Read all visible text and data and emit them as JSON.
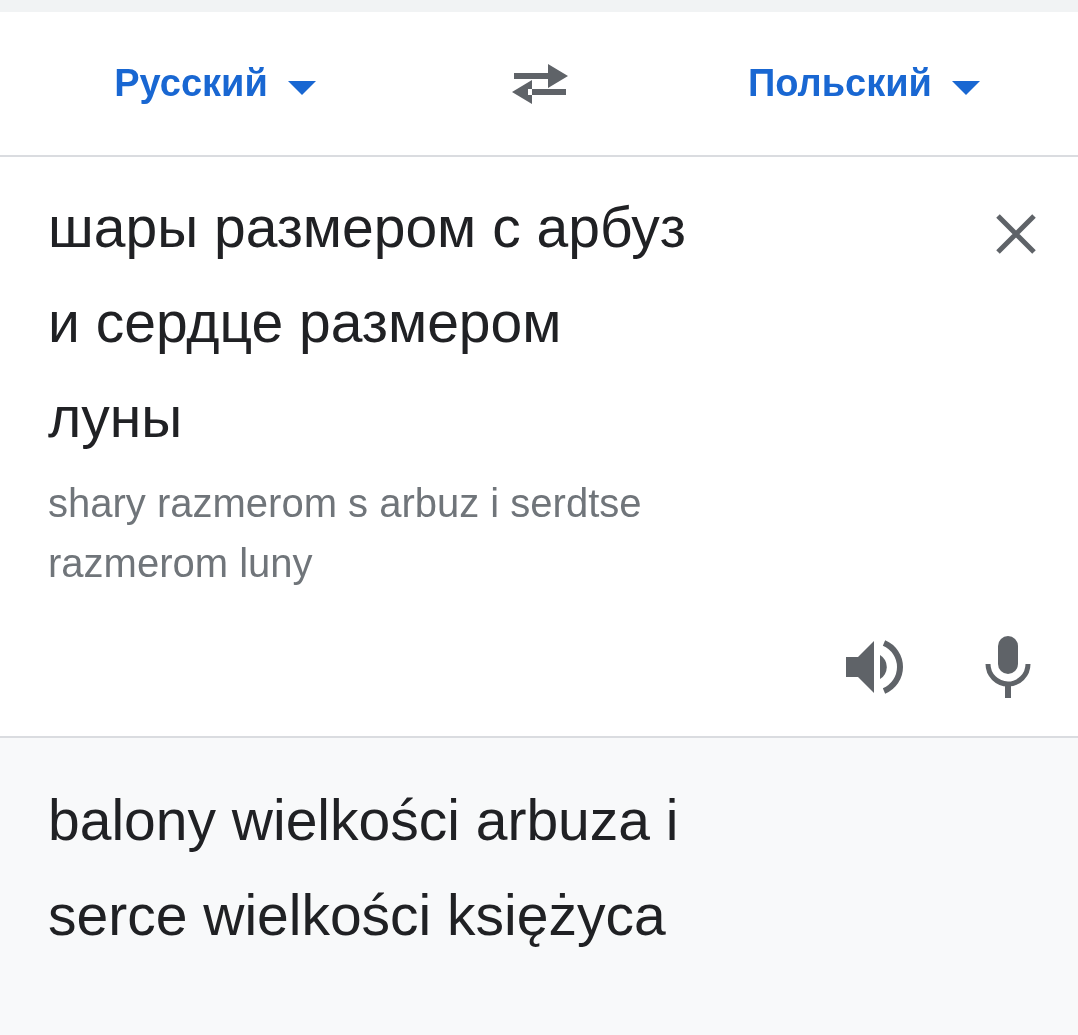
{
  "languages": {
    "source": "Русский",
    "target": "Польский"
  },
  "source": {
    "lines": [
      "шары размером с арбуз",
      "и сердце размером",
      "луны"
    ],
    "transliteration": [
      "shary razmerom s arbuz i serdtse",
      "razmerom luny"
    ]
  },
  "translation": {
    "lines": [
      "balony wielkości arbuza i",
      "serce wielkości księżyca"
    ]
  }
}
